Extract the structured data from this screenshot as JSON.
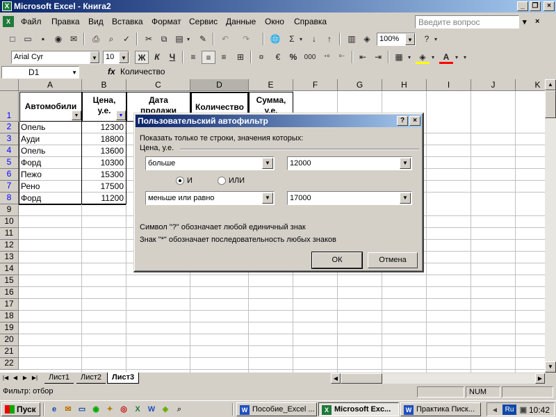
{
  "window": {
    "title": "Microsoft Excel - Книга2",
    "app_icon": "excel-icon",
    "doc_icon": "workbook-icon"
  },
  "menu": {
    "items": [
      "Файл",
      "Правка",
      "Вид",
      "Вставка",
      "Формат",
      "Сервис",
      "Данные",
      "Окно",
      "Справка"
    ],
    "help_placeholder": "Введите вопрос"
  },
  "toolbar": {
    "zoom": "100%",
    "font_name": "Arial Cyr",
    "font_size": "10",
    "bold": "Ж",
    "italic": "К",
    "underline": "Ч",
    "percent": "%",
    "thousands": "000"
  },
  "formula_bar": {
    "name_box": "D1",
    "fx": "fx",
    "value": "Количество"
  },
  "sheet": {
    "columns": [
      "A",
      "B",
      "C",
      "D",
      "E",
      "F",
      "G",
      "H",
      "I",
      "J",
      "K"
    ],
    "rows": [
      "1",
      "2",
      "3",
      "4",
      "5",
      "6",
      "7",
      "8",
      "9",
      "10",
      "11",
      "12",
      "13",
      "14",
      "15",
      "16",
      "17",
      "18",
      "19",
      "20",
      "21",
      "22"
    ],
    "header_cells": {
      "a1": "Автомобили",
      "b1_line1": "Цена,",
      "b1_line2": "у.е.",
      "c1_line1": "Дата",
      "c1_line2": "продажи",
      "d1": "Количество",
      "e1_line1": "Сумма,",
      "e1_line2": "у.е."
    },
    "data": [
      {
        "car": "Опель",
        "price": "12300"
      },
      {
        "car": "Ауди",
        "price": "18800"
      },
      {
        "car": "Опель",
        "price": "13600"
      },
      {
        "car": "Форд",
        "price": "10300"
      },
      {
        "car": "Пежо",
        "price": "15300"
      },
      {
        "car": "Рено",
        "price": "17500"
      },
      {
        "car": "Форд",
        "price": "11200"
      }
    ]
  },
  "tabs": [
    "Лист1",
    "Лист2",
    "Лист3"
  ],
  "status": {
    "text": "Фильтр: отбор",
    "num": "NUM"
  },
  "dialog": {
    "title": "Пользовательский автофильтр",
    "instruction": "Показать только те строки, значения которых:",
    "field": "Цена, у.е.",
    "cond1_op": "больше",
    "cond1_val": "12000",
    "radio_and": "И",
    "radio_or": "ИЛИ",
    "cond2_op": "меньше или равно",
    "cond2_val": "17000",
    "hint1": "Символ \"?\" обозначает любой единичный знак",
    "hint2": "Знак \"*\" обозначает последовательность любых знаков",
    "ok": "ОК",
    "cancel": "Отмена"
  },
  "taskbar": {
    "start": "Пуск",
    "tasks": [
      "Пособие_Excel ...",
      "Microsoft Exc...",
      "Практика Писк..."
    ],
    "lang": "Ru",
    "clock": "10:42"
  }
}
